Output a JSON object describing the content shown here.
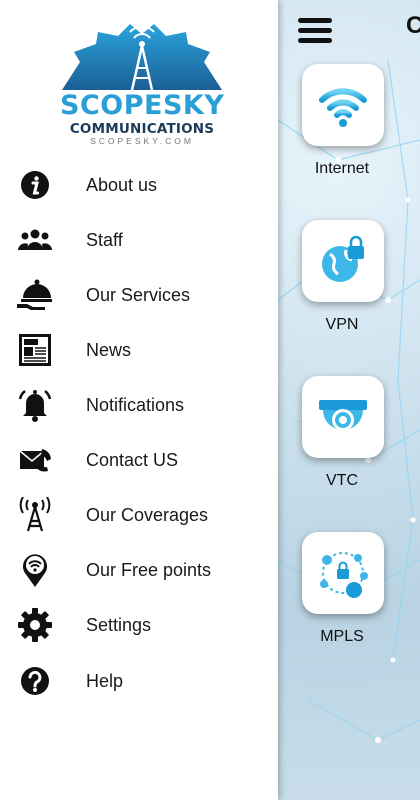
{
  "header": {
    "title_partial": "C"
  },
  "logo": {
    "brand": "SCOPESKY",
    "subtitle": "COMMUNICATIONS",
    "domain": "SCOPESKY.COM"
  },
  "menu": [
    {
      "label": "About us",
      "icon": "info-icon"
    },
    {
      "label": "Staff",
      "icon": "people-icon"
    },
    {
      "label": "Our Services",
      "icon": "service-bell-icon"
    },
    {
      "label": "News",
      "icon": "newspaper-icon"
    },
    {
      "label": "Notifications",
      "icon": "bell-icon"
    },
    {
      "label": "Contact US",
      "icon": "envelope-phone-icon"
    },
    {
      "label": "Our Coverages",
      "icon": "antenna-icon"
    },
    {
      "label": "Our Free points",
      "icon": "wifi-pin-icon"
    },
    {
      "label": "Settings",
      "icon": "gear-icon"
    },
    {
      "label": "Help",
      "icon": "help-icon"
    }
  ],
  "services": [
    {
      "label": "Internet",
      "icon": "wifi-icon"
    },
    {
      "label": "VPN",
      "icon": "globe-lock-icon"
    },
    {
      "label": "VTC",
      "icon": "camera-icon"
    },
    {
      "label": "MPLS",
      "icon": "network-lock-icon"
    }
  ],
  "colors": {
    "accent": "#2a9fd6",
    "accent_light": "#5bc8ee",
    "dark": "#111111"
  }
}
